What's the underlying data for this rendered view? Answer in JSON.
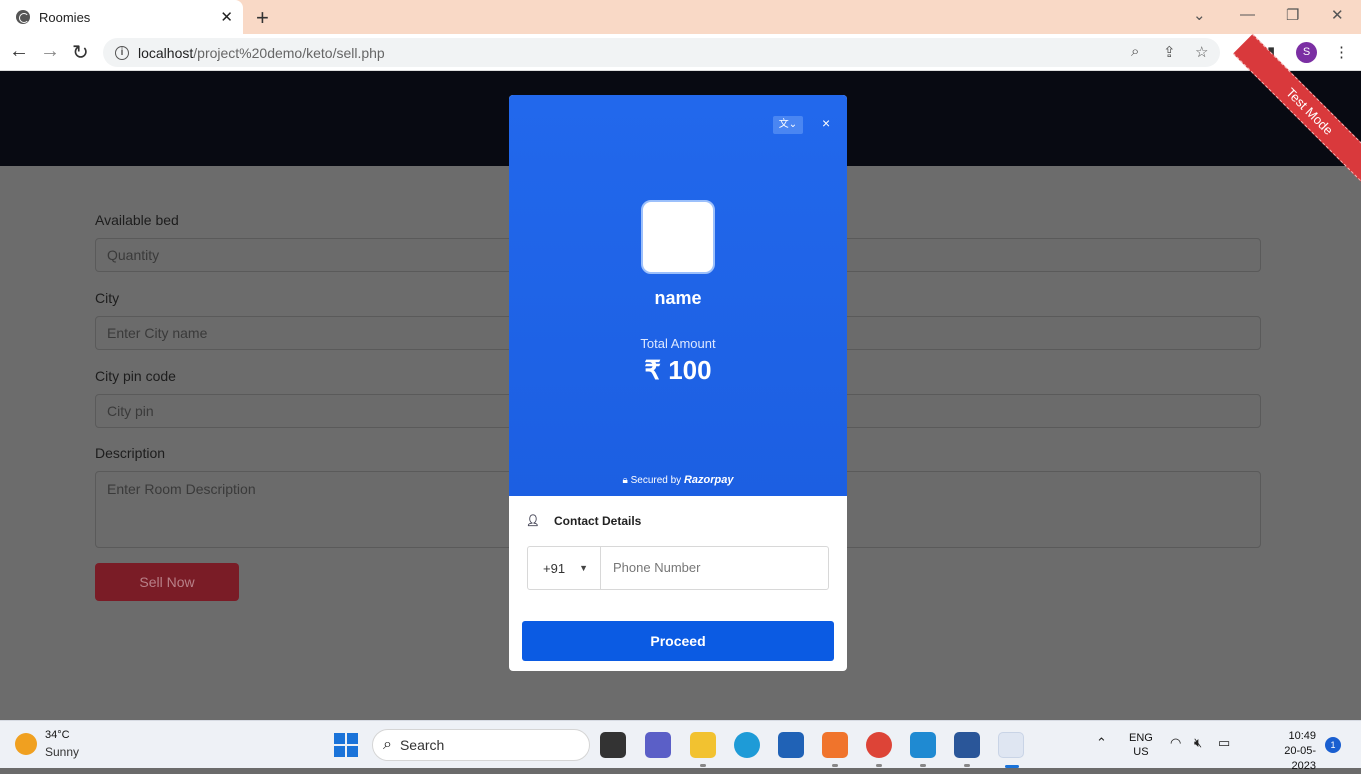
{
  "browser": {
    "tab_title": "Roomies",
    "tab_close": "✕",
    "new_tab": "+",
    "url_main": "localhost",
    "url_path": "/project%20demo/keto/sell.php",
    "profile_initial": "S"
  },
  "page": {
    "ribbon": "Test Mode",
    "fields": [
      {
        "label": "Available bed",
        "placeholder": "Quantity"
      },
      {
        "label": "City",
        "placeholder": "Enter City name"
      },
      {
        "label": "City pin code",
        "placeholder": "City pin"
      },
      {
        "label": "Description",
        "placeholder": "Enter Room Description"
      }
    ],
    "sell_button": "Sell Now"
  },
  "checkout": {
    "merchant_name": "name",
    "total_label": "Total Amount",
    "total_amount": "₹ 100",
    "secured_by": "Secured by",
    "brand": "Razorpay",
    "contact_title": "Contact Details",
    "country_code": "+91",
    "phone_placeholder": "Phone Number",
    "proceed": "Proceed",
    "close": "×"
  },
  "taskbar": {
    "temperature": "34°C",
    "condition": "Sunny",
    "search": "Search",
    "lang_line1": "ENG",
    "lang_line2": "US",
    "time": "10:49",
    "date": "20-05-2023",
    "notifications": "1"
  },
  "colors": {
    "accent": "#2268ec",
    "proceed": "#0b5be3",
    "ribbon": "#d9393c",
    "sell_button": "#7a1c26"
  }
}
